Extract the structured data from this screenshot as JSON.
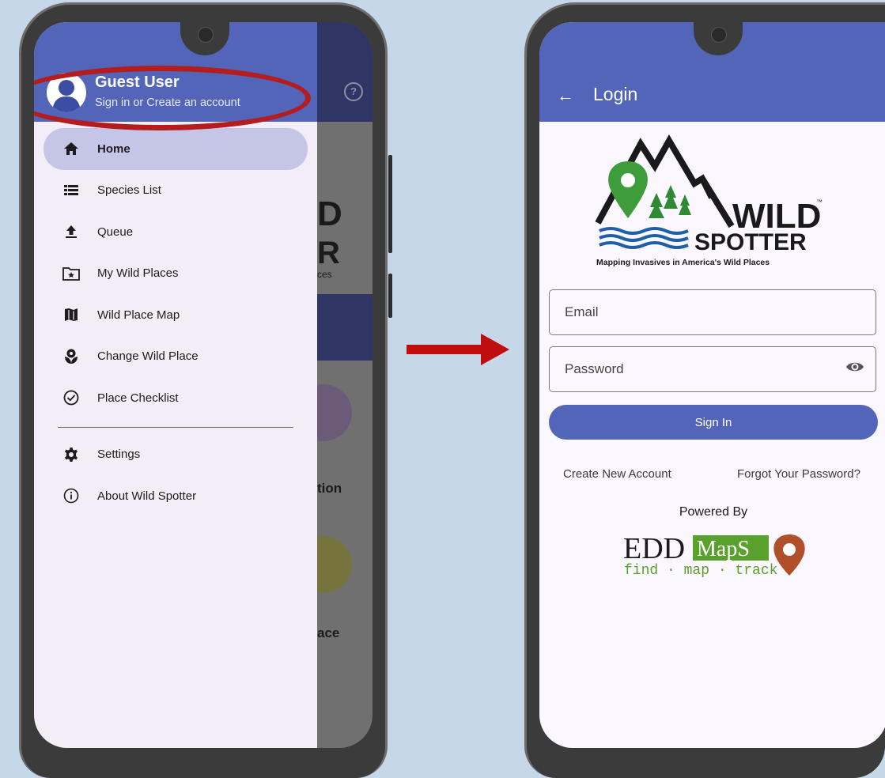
{
  "drawer": {
    "user_name": "Guest User",
    "user_subtitle": "Sign in or Create an account",
    "items": [
      {
        "label": "Home",
        "icon": "home-icon",
        "active": true
      },
      {
        "label": "Species List",
        "icon": "list-icon"
      },
      {
        "label": "Queue",
        "icon": "upload-icon"
      },
      {
        "label": "My Wild Places",
        "icon": "folder-star-icon"
      },
      {
        "label": "Wild Place Map",
        "icon": "map-icon"
      },
      {
        "label": "Change Wild Place",
        "icon": "flower-icon"
      },
      {
        "label": "Place Checklist",
        "icon": "check-circle-icon"
      }
    ],
    "secondary_items": [
      {
        "label": "Settings",
        "icon": "gear-icon"
      },
      {
        "label": "About Wild Spotter",
        "icon": "info-icon"
      }
    ]
  },
  "background_app": {
    "fragments": [
      "D",
      "R",
      "ces",
      "tion",
      "ace"
    ]
  },
  "login": {
    "title": "Login",
    "logo": {
      "word1": "WILD",
      "word2": "SPOTTER",
      "tagline": "Mapping Invasives in America's Wild Places",
      "tm": "™"
    },
    "email_placeholder": "Email",
    "password_placeholder": "Password",
    "sign_in_label": "Sign In",
    "create_account_label": "Create New Account",
    "forgot_password_label": "Forgot Your Password?",
    "powered_by": "Powered By",
    "eddmaps": {
      "edd": "EDD",
      "maps": "MapS",
      "tagline": "find · map · track"
    }
  },
  "colors": {
    "primary": "#5365b8",
    "active_item": "#c5c6e7",
    "annotation_red": "#b31d1d",
    "eddmaps_green": "#5aa02c",
    "eddmaps_pin": "#b0502a"
  }
}
